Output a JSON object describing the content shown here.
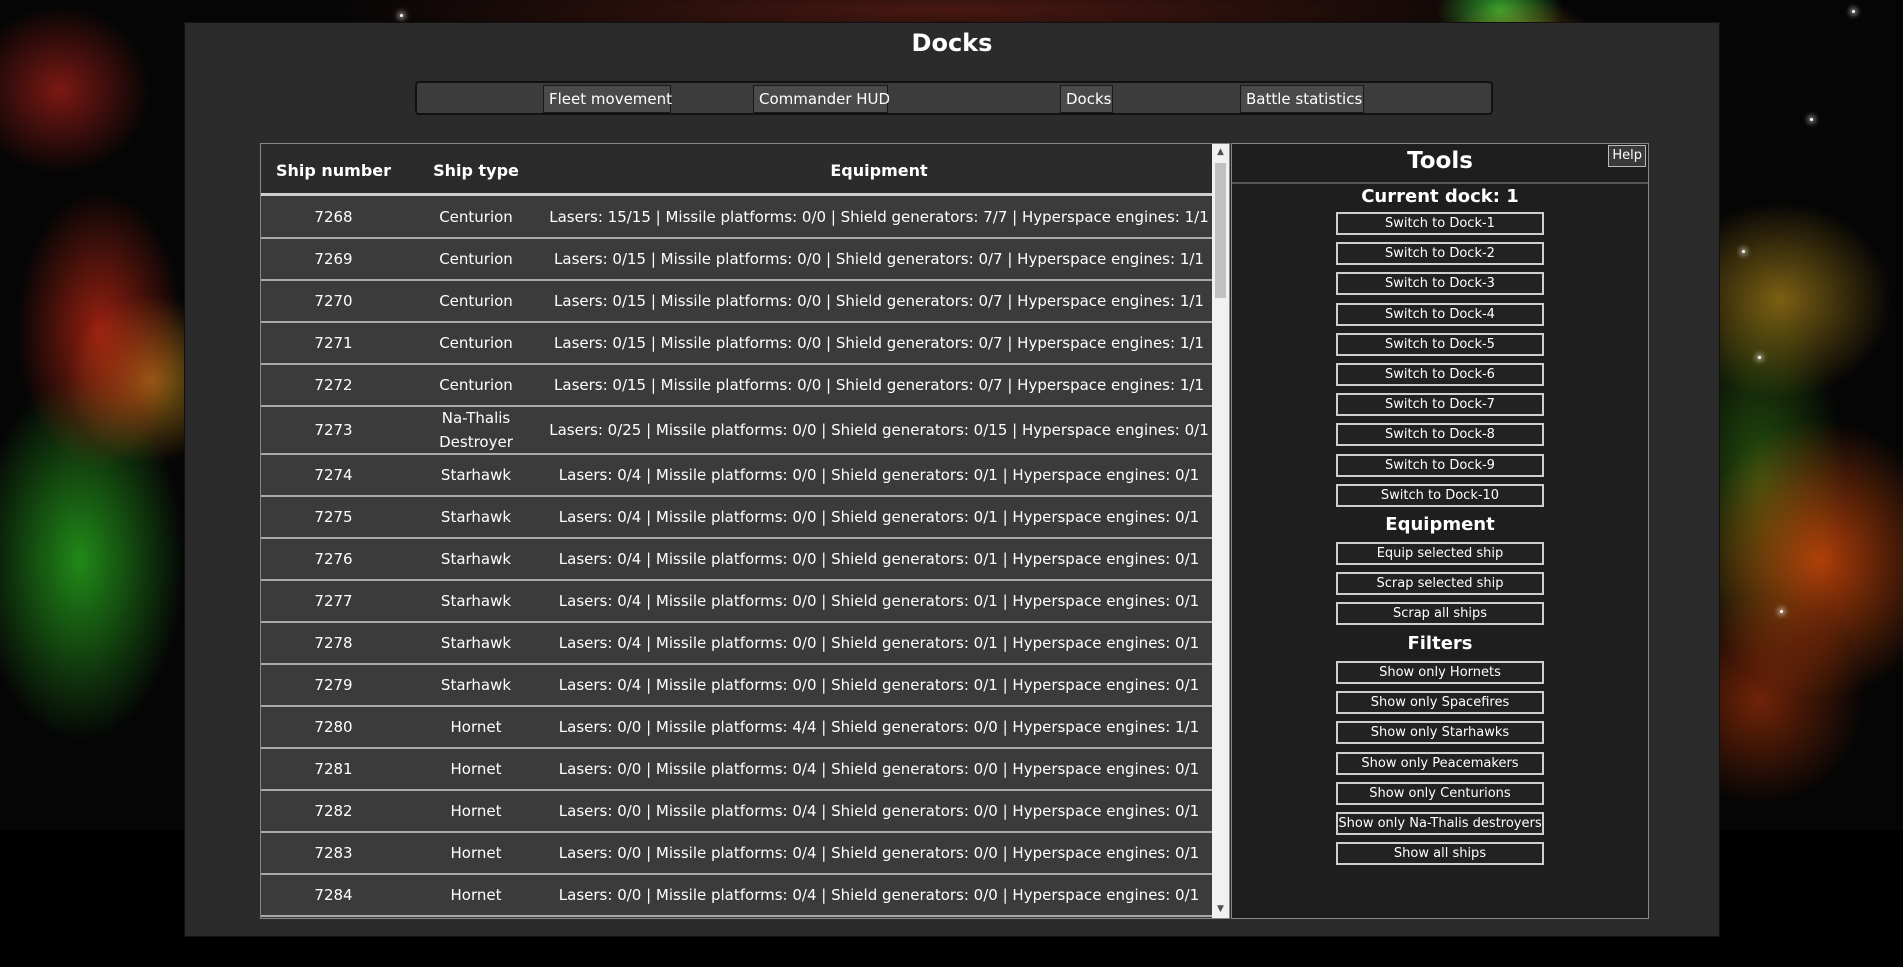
{
  "page": {
    "title": "Docks"
  },
  "nav": [
    {
      "label": "Fleet movement"
    },
    {
      "label": "Commander HUD"
    },
    {
      "label": "Docks"
    },
    {
      "label": "Battle statistics"
    }
  ],
  "table": {
    "headers": {
      "ship_number": "Ship number",
      "ship_type": "Ship type",
      "equipment": "Equipment"
    },
    "rows": [
      {
        "num": "7268",
        "type": "Centurion",
        "equip": "Lasers: 15/15 | Missile platforms: 0/0 | Shield generators: 7/7 | Hyperspace engines: 1/1"
      },
      {
        "num": "7269",
        "type": "Centurion",
        "equip": "Lasers: 0/15 | Missile platforms: 0/0 | Shield generators: 0/7 | Hyperspace engines: 1/1"
      },
      {
        "num": "7270",
        "type": "Centurion",
        "equip": "Lasers: 0/15 | Missile platforms: 0/0 | Shield generators: 0/7 | Hyperspace engines: 1/1"
      },
      {
        "num": "7271",
        "type": "Centurion",
        "equip": "Lasers: 0/15 | Missile platforms: 0/0 | Shield generators: 0/7 | Hyperspace engines: 1/1"
      },
      {
        "num": "7272",
        "type": "Centurion",
        "equip": "Lasers: 0/15 | Missile platforms: 0/0 | Shield generators: 0/7 | Hyperspace engines: 1/1"
      },
      {
        "num": "7273",
        "type": "Na-Thalis Destroyer",
        "equip": "Lasers: 0/25 | Missile platforms: 0/0 | Shield generators: 0/15 | Hyperspace engines: 0/1"
      },
      {
        "num": "7274",
        "type": "Starhawk",
        "equip": "Lasers: 0/4 | Missile platforms: 0/0 | Shield generators: 0/1 | Hyperspace engines: 0/1"
      },
      {
        "num": "7275",
        "type": "Starhawk",
        "equip": "Lasers: 0/4 | Missile platforms: 0/0 | Shield generators: 0/1 | Hyperspace engines: 0/1"
      },
      {
        "num": "7276",
        "type": "Starhawk",
        "equip": "Lasers: 0/4 | Missile platforms: 0/0 | Shield generators: 0/1 | Hyperspace engines: 0/1"
      },
      {
        "num": "7277",
        "type": "Starhawk",
        "equip": "Lasers: 0/4 | Missile platforms: 0/0 | Shield generators: 0/1 | Hyperspace engines: 0/1"
      },
      {
        "num": "7278",
        "type": "Starhawk",
        "equip": "Lasers: 0/4 | Missile platforms: 0/0 | Shield generators: 0/1 | Hyperspace engines: 0/1"
      },
      {
        "num": "7279",
        "type": "Starhawk",
        "equip": "Lasers: 0/4 | Missile platforms: 0/0 | Shield generators: 0/1 | Hyperspace engines: 0/1"
      },
      {
        "num": "7280",
        "type": "Hornet",
        "equip": "Lasers: 0/0 | Missile platforms: 4/4 | Shield generators: 0/0 | Hyperspace engines: 1/1"
      },
      {
        "num": "7281",
        "type": "Hornet",
        "equip": "Lasers: 0/0 | Missile platforms: 0/4 | Shield generators: 0/0 | Hyperspace engines: 0/1"
      },
      {
        "num": "7282",
        "type": "Hornet",
        "equip": "Lasers: 0/0 | Missile platforms: 0/4 | Shield generators: 0/0 | Hyperspace engines: 0/1"
      },
      {
        "num": "7283",
        "type": "Hornet",
        "equip": "Lasers: 0/0 | Missile platforms: 0/4 | Shield generators: 0/0 | Hyperspace engines: 0/1"
      },
      {
        "num": "7284",
        "type": "Hornet",
        "equip": "Lasers: 0/0 | Missile platforms: 0/4 | Shield generators: 0/0 | Hyperspace engines: 0/1"
      }
    ]
  },
  "tools": {
    "title": "Tools",
    "help_label": "Help",
    "current_dock": "Current dock: 1",
    "dock_buttons": [
      "Switch to Dock-1",
      "Switch to Dock-2",
      "Switch to Dock-3",
      "Switch to Dock-4",
      "Switch to Dock-5",
      "Switch to Dock-6",
      "Switch to Dock-7",
      "Switch to Dock-8",
      "Switch to Dock-9",
      "Switch to Dock-10"
    ],
    "equipment_title": "Equipment",
    "equipment_buttons": [
      "Equip selected ship",
      "Scrap selected ship",
      "Scrap all ships"
    ],
    "filters_title": "Filters",
    "filter_buttons": [
      "Show only Hornets",
      "Show only Spacefires",
      "Show only Starhawks",
      "Show only Peacemakers",
      "Show only Centurions",
      "Show only Na-Thalis destroyers",
      "Show all ships"
    ]
  },
  "icons": {
    "scroll_up": "chevron-up-icon",
    "scroll_down": "chevron-down-icon"
  }
}
